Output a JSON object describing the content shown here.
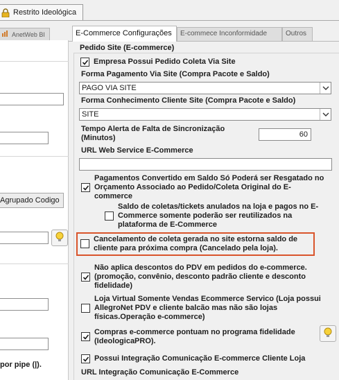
{
  "top_tab": {
    "label": "Restrito Ideológica"
  },
  "left": {
    "tab_label": "AnetWeb BI",
    "button_label": "Agrupado Codigo",
    "footer_text": "por pipe (|)."
  },
  "tabs": [
    {
      "label": "E-Commerce Configurações",
      "active": true
    },
    {
      "label": "E-commece Inconformidade",
      "active": false
    },
    {
      "label": "Outros",
      "active": false
    }
  ],
  "group": {
    "title": "Pedido Site (E-commerce)",
    "cb_pedido_coleta": {
      "label": "Empresa Possui Pedido Coleta Via Site",
      "checked": true
    },
    "forma_pagamento": {
      "label": "Forma Pagamento Via Site (Compra Pacote e Saldo)",
      "value": "PAGO VIA SITE"
    },
    "forma_conhecimento": {
      "label": "Forma Conhecimento Cliente Site (Compra Pacote e Saldo)",
      "value": "SITE"
    },
    "tempo_alerta": {
      "label_line1": "Tempo Alerta de Falta de Sincronização",
      "label_line2": "(Minutos)",
      "value": "60"
    },
    "url_ws": {
      "label": "URL Web Service E-Commerce",
      "value": ""
    },
    "cb_pagamentos": {
      "line1": "Pagamentos Convertido em Saldo Só Poderá ser Resgatado no",
      "line2": "Orçamento Associado ao Pedido/Coleta Original do E-",
      "line3": "commerce",
      "checked": true
    },
    "cb_saldo_coletas": {
      "line1": "Saldo de coletas/tickets anulados na loja e pagos no E-",
      "line2": "Commerce somente poderão ser reutilizados na",
      "line3": "plataforma de E-Commerce",
      "checked": false
    },
    "cb_cancelamento": {
      "line1": "Cancelamento de coleta gerada no site estorna saldo de",
      "line2": "cliente para próxima compra (Cancelado pela loja).",
      "checked": false
    },
    "cb_descontos": {
      "line1": "Não aplica descontos do PDV em pedidos do e-commerce.",
      "line2": "(promoção, convênio, desconto padrão cliente e desconto",
      "line3": "fidelidade)",
      "checked": true
    },
    "cb_loja_virtual": {
      "line1": "Loja Virtual Somente Vendas Ecommerce Servico (Loja possui",
      "line2": "AllegroNet PDV e cliente balcão mas não são lojas",
      "line3": "físicas.Operação e-commerce)",
      "checked": false
    },
    "cb_fidelidade": {
      "line1": "Compras e-commerce pontuam no programa fidelidade",
      "line2": "(IdeologicaPRO).",
      "checked": true
    },
    "cb_integracao": {
      "label": "Possui Integração Comunicação E-commerce Cliente Loja",
      "checked": true
    },
    "url_integracao": {
      "label": "URL Integração Comunicação E-Commerce"
    }
  },
  "colors": {
    "highlight": "#d9542b",
    "check": "#1a1a1a"
  }
}
